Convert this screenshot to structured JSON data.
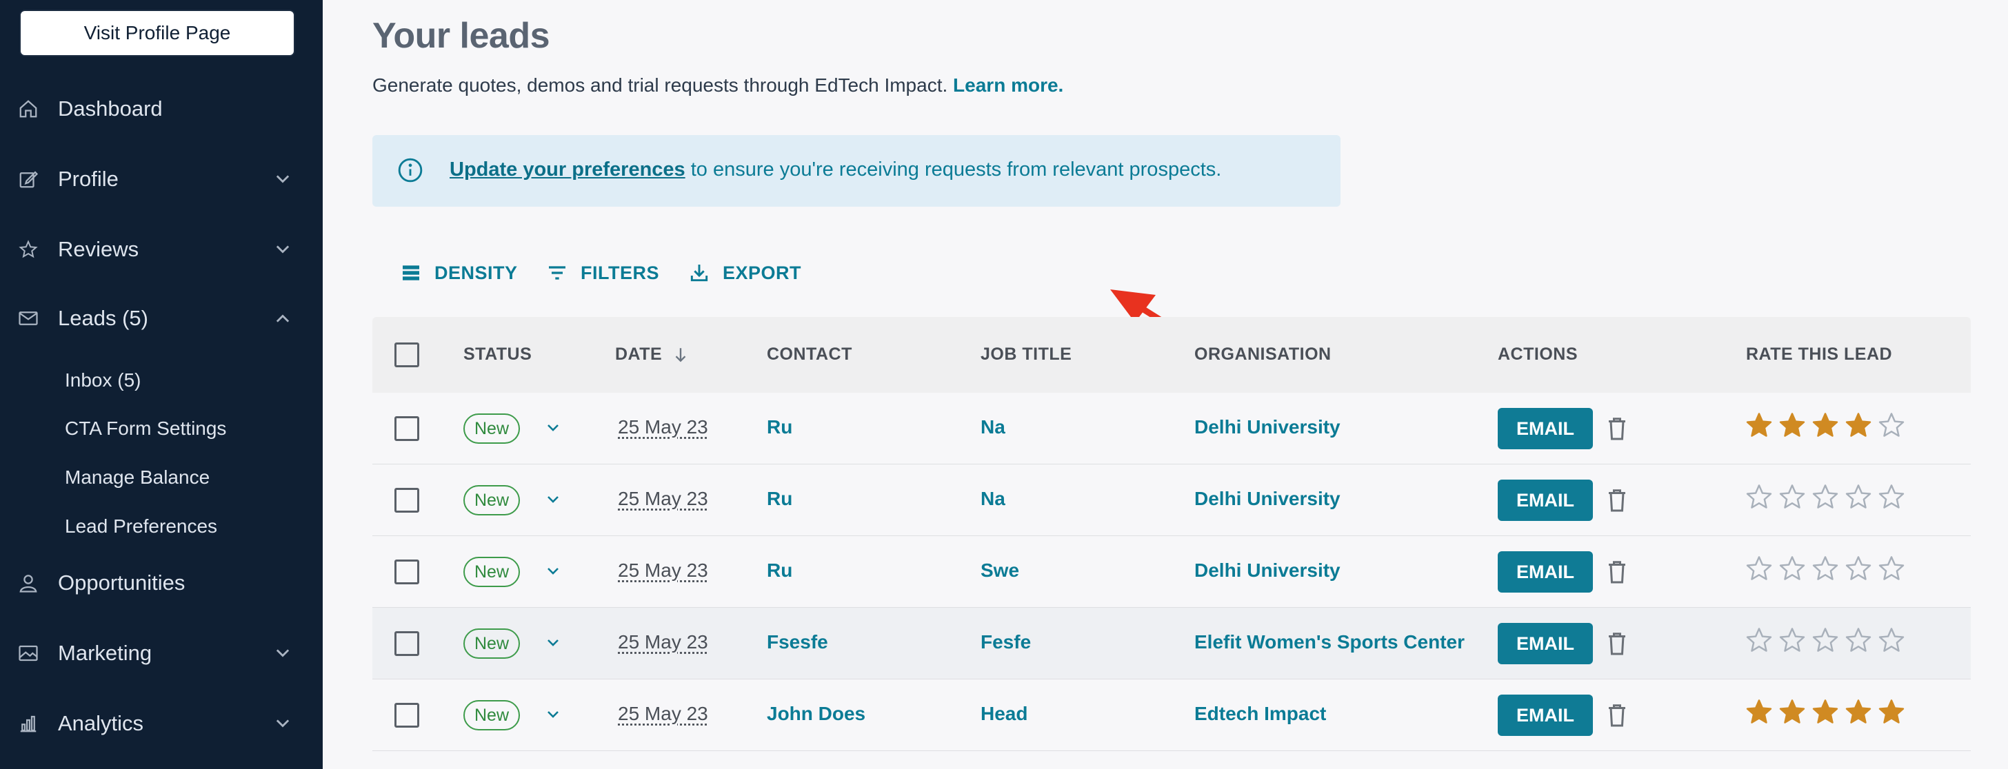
{
  "sidebar": {
    "visit_profile": "Visit Profile Page",
    "nav": [
      {
        "label": "Dashboard",
        "icon": "home-icon"
      },
      {
        "label": "Profile",
        "icon": "edit-icon"
      },
      {
        "label": "Reviews",
        "icon": "star-icon"
      },
      {
        "label": "Leads (5)",
        "icon": "mail-icon"
      },
      {
        "label": "Opportunities",
        "icon": "person-icon"
      },
      {
        "label": "Marketing",
        "icon": "image-icon"
      },
      {
        "label": "Analytics",
        "icon": "bar-chart-icon"
      }
    ],
    "leads_sub": [
      "Inbox (5)",
      "CTA Form Settings",
      "Manage Balance",
      "Lead Preferences"
    ]
  },
  "page": {
    "title": "Your leads",
    "subtitle": "Generate quotes, demos and trial requests through EdTech Impact.",
    "learn_more": "Learn more.",
    "info_link": "Update your preferences",
    "info_rest": "to ensure you're receiving requests from relevant prospects."
  },
  "toolbar": {
    "density": "DENSITY",
    "filters": "FILTERS",
    "export": "EXPORT"
  },
  "table": {
    "headers": {
      "status": "STATUS",
      "date": "DATE",
      "contact": "CONTACT",
      "job_title": "JOB TITLE",
      "organisation": "ORGANISATION",
      "actions": "ACTIONS",
      "rate": "RATE THIS LEAD"
    },
    "email_label": "EMAIL",
    "rows": [
      {
        "status": "New",
        "date": "25 May 23",
        "contact": "Ru",
        "job_title": "Na",
        "organisation": "Delhi University",
        "rating": 4
      },
      {
        "status": "New",
        "date": "25 May 23",
        "contact": "Ru",
        "job_title": "Na",
        "organisation": "Delhi University",
        "rating": 0
      },
      {
        "status": "New",
        "date": "25 May 23",
        "contact": "Ru",
        "job_title": "Swe",
        "organisation": "Delhi University",
        "rating": 0
      },
      {
        "status": "New",
        "date": "25 May 23",
        "contact": "Fsesfe",
        "job_title": "Fesfe",
        "organisation": "Elefit Women's Sports Center",
        "rating": 0
      },
      {
        "status": "New",
        "date": "25 May 23",
        "contact": "John Does",
        "job_title": "Head",
        "organisation": "Edtech Impact",
        "rating": 5
      }
    ]
  },
  "colors": {
    "sidebar_bg": "#0f1f33",
    "accent": "#0b7b95",
    "status_green": "#3d9b4a",
    "star_filled": "#d08a22",
    "star_empty": "#a8b0ba",
    "arrow_red": "#e8321f"
  }
}
